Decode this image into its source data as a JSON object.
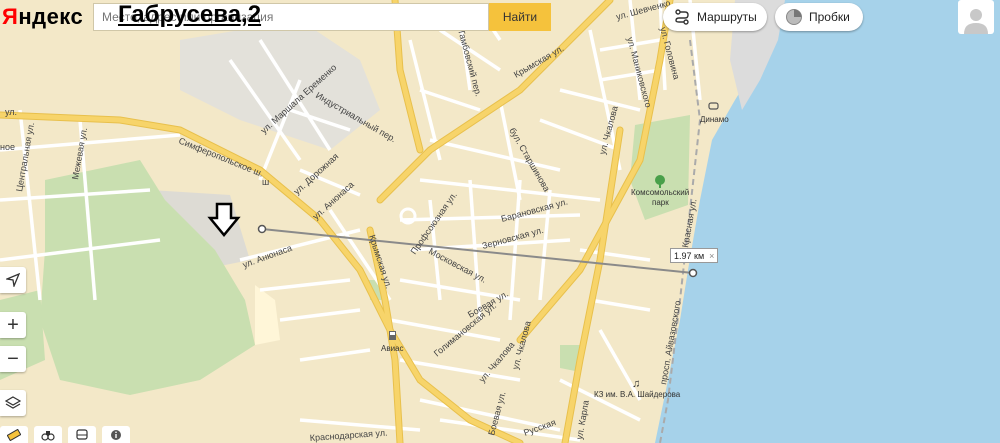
{
  "logo": {
    "first": "Я",
    "rest": "ндекс"
  },
  "search": {
    "placeholder": "Место, адрес или организация",
    "overlay_text": "Габрусева,2",
    "button": "Найти"
  },
  "toolbar": {
    "routes": "Маршруты",
    "traffic": "Пробки"
  },
  "controls": {
    "zoom_in": "+",
    "zoom_out": "−"
  },
  "ruler": {
    "distance": "1.97 км",
    "close": "×"
  },
  "streets": {
    "simferopolskoe": "Симферопольское ш.",
    "anyunasa_1": "ул. Анюнаса",
    "anyunasa_2": "ул. Анюнаса",
    "dorozhnaya": "ул. Дорожная",
    "marshala": "ул. Маршала Еременко",
    "industrialny": "Индустриальный пер.",
    "krymskaya_1": "Крымская ул.",
    "krymskaya_2": "Крымская ул.",
    "profsoyuznaya": "Профсоюзная ул.",
    "moskovskaya": "Московская ул.",
    "baranovskaya": "Барановская ул.",
    "zernovskaya": "Зерновская ул.",
    "golimanovskaya": "Голимановская ул.",
    "boevaya_1": "Боевая ул.",
    "boevaya_2": "Боевая ул.",
    "chkalova_1": "ул. Чкалова",
    "chkalova_2": "ул. Чкалова",
    "chkalova_3": "ул. Чкалова",
    "stratsishona": "бул. Старшинова",
    "tambovsky": "Тамбовский пер.",
    "shevchenko": "ул. Шевченко",
    "golovina": "ул. Головина",
    "manikovskogo": "ул. Маниковского",
    "krasnoarmeiskaya": "Краснодарская ул.",
    "russkaya": "Русская",
    "karla": "ул. Карла",
    "aivazovskogo": "просп. Айвазовского",
    "krasnaya": "Красная ул.",
    "mezhevaya": "Межевая ул.",
    "centralnaya": "Центральная ул.",
    "edge_ul": "ул.",
    "edge_noe": "ное",
    "edge_sh": "ш"
  },
  "poi": {
    "park_line1": "Комсомольский",
    "park_line2": "парк",
    "dinamo": "Динамо",
    "avias": "Авиас",
    "kz": "КЗ им. В.А. Шайдерова"
  },
  "colors": {
    "land": "#f3e8c8",
    "sea": "#a6d2ea",
    "green": "#c9dfb0",
    "main_road": "#f7d46a",
    "minor_road": "#ffffff",
    "search_button": "#f5c23c",
    "logo_red": "#ff0000"
  }
}
